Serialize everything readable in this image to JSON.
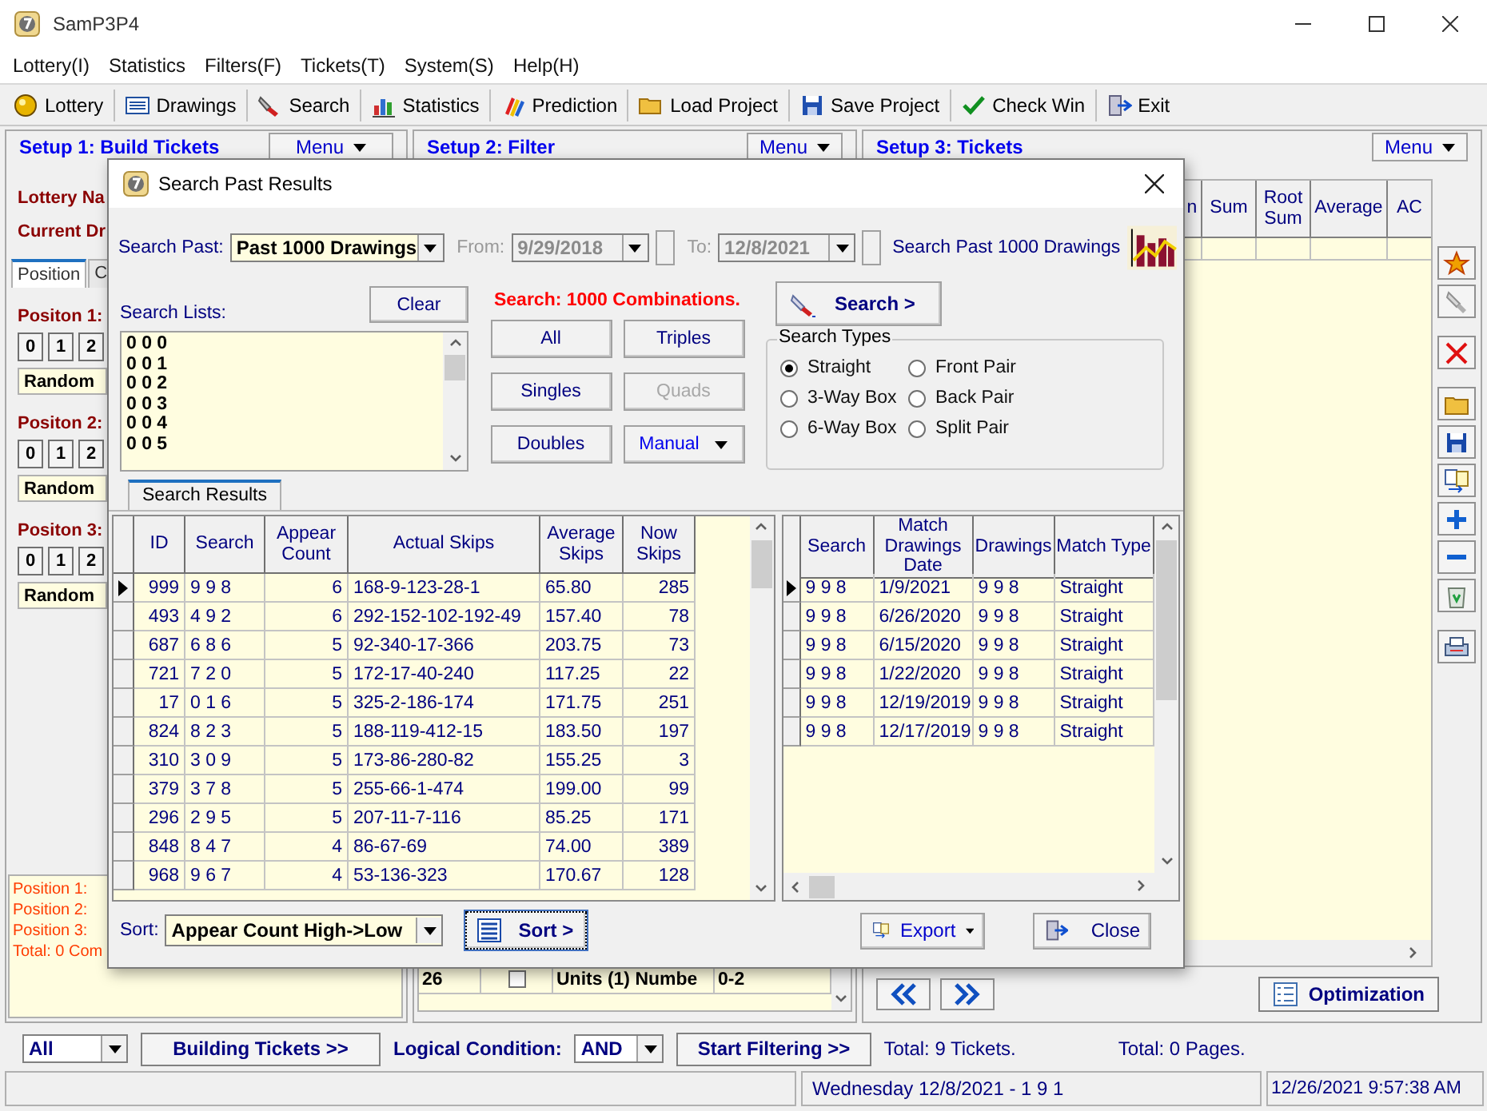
{
  "window": {
    "title": "SamP3P4"
  },
  "menu": [
    "Lottery(I)",
    "Statistics",
    "Filters(F)",
    "Tickets(T)",
    "System(S)",
    "Help(H)"
  ],
  "toolbar": [
    "Lottery",
    "Drawings",
    "Search",
    "Statistics",
    "Prediction",
    "Load Project",
    "Save Project",
    "Check Win",
    "Exit"
  ],
  "panel1": {
    "title": "Setup 1: Build Tickets",
    "menu_button": "Menu",
    "fields": [
      "Lottery Na",
      "Current Dr"
    ],
    "tabs": [
      {
        "label": "Position",
        "selected": true
      },
      {
        "label": "C",
        "selected": false
      }
    ],
    "positions": [
      {
        "label": "Positon 1:",
        "digits": [
          "0",
          "1",
          "2"
        ],
        "mode": "Random"
      },
      {
        "label": "Positon 2:",
        "digits": [
          "0",
          "1",
          "2"
        ],
        "mode": "Random"
      },
      {
        "label": "Positon 3:",
        "digits": [
          "0",
          "1",
          "2"
        ],
        "mode": "Random"
      }
    ],
    "summary": [
      "Position 1:",
      "Position 2:",
      "Position 3:",
      "Total: 0 Com"
    ]
  },
  "panel2": {
    "title": "Setup 2: Filter",
    "menu_button": "Menu",
    "row": {
      "number": "26",
      "checked": false,
      "name": "Units (1) Numbe",
      "range": "0-2"
    }
  },
  "panel3": {
    "title": "Setup 3: Tickets",
    "menu_button": "Menu",
    "columns": [
      "n",
      "Sum",
      "Root Sum",
      "Average",
      "AC"
    ],
    "optimization_button": "Optimization"
  },
  "dialog": {
    "title": "Search Past Results",
    "search_past_label": "Search Past:",
    "search_past": "Past 1000 Drawings",
    "from_label": "From:",
    "from": "9/29/2018",
    "to_label": "To:",
    "to": "12/8/2021",
    "dates_disabled": true,
    "range_note": "Search Past 1000 Drawings",
    "lists_label": "Search Lists:",
    "clear_button": "Clear",
    "search_list": [
      "0 0 0",
      "0 0 1",
      "0 0 2",
      "0 0 3",
      "0 0 4",
      "0 0 5"
    ],
    "combinations": "Search: 1000 Combinations.",
    "quick_buttons": [
      {
        "label": "All",
        "kind": "plain",
        "disabled": false
      },
      {
        "label": "Triples",
        "kind": "plain",
        "disabled": false
      },
      {
        "label": "Singles",
        "kind": "plain",
        "disabled": false
      },
      {
        "label": "Quads",
        "kind": "plain",
        "disabled": true
      },
      {
        "label": "Doubles",
        "kind": "plain",
        "disabled": false
      },
      {
        "label": "Manual",
        "kind": "dropdown",
        "disabled": false
      }
    ],
    "search_button": "Search >",
    "search_types_label": "Search Types",
    "search_types": [
      {
        "label": "Straight",
        "selected": true
      },
      {
        "label": "Front Pair",
        "selected": false
      },
      {
        "label": "3-Way Box",
        "selected": false
      },
      {
        "label": "Back Pair",
        "selected": false
      },
      {
        "label": "6-Way Box",
        "selected": false
      },
      {
        "label": "Split Pair",
        "selected": false
      }
    ],
    "results_tab": "Search Results",
    "results": {
      "columns": [
        "ID",
        "Search",
        "Appear Count",
        "Actual Skips",
        "Average Skips",
        "Now Skips"
      ],
      "rows": [
        {
          "selected": true,
          "cells": [
            "999",
            "9 9 8",
            "6",
            "168-9-123-28-1",
            "65.80",
            "285"
          ]
        },
        {
          "selected": false,
          "cells": [
            "493",
            "4 9 2",
            "6",
            "292-152-102-192-49",
            "157.40",
            "78"
          ]
        },
        {
          "selected": false,
          "cells": [
            "687",
            "6 8 6",
            "5",
            "92-340-17-366",
            "203.75",
            "73"
          ]
        },
        {
          "selected": false,
          "cells": [
            "721",
            "7 2 0",
            "5",
            "172-17-40-240",
            "117.25",
            "22"
          ]
        },
        {
          "selected": false,
          "cells": [
            "17",
            "0 1 6",
            "5",
            "325-2-186-174",
            "171.75",
            "251"
          ]
        },
        {
          "selected": false,
          "cells": [
            "824",
            "8 2 3",
            "5",
            "188-119-412-15",
            "183.50",
            "197"
          ]
        },
        {
          "selected": false,
          "cells": [
            "310",
            "3 0 9",
            "5",
            "173-86-280-82",
            "155.25",
            "3"
          ]
        },
        {
          "selected": false,
          "cells": [
            "379",
            "3 7 8",
            "5",
            "255-66-1-474",
            "199.00",
            "99"
          ]
        },
        {
          "selected": false,
          "cells": [
            "296",
            "2 9 5",
            "5",
            "207-11-7-116",
            "85.25",
            "171"
          ]
        },
        {
          "selected": false,
          "cells": [
            "848",
            "8 4 7",
            "4",
            "86-67-69",
            "74.00",
            "389"
          ]
        },
        {
          "selected": false,
          "cells": [
            "968",
            "9 6 7",
            "4",
            "53-136-323",
            "170.67",
            "128"
          ]
        }
      ]
    },
    "matches": {
      "columns": [
        "Search",
        "Match Drawings Date",
        "Drawings",
        "Match Type"
      ],
      "rows": [
        {
          "selected": true,
          "cells": [
            "9 9 8",
            "1/9/2021",
            "9 9 8",
            "Straight"
          ]
        },
        {
          "selected": false,
          "cells": [
            "9 9 8",
            "6/26/2020",
            "9 9 8",
            "Straight"
          ]
        },
        {
          "selected": false,
          "cells": [
            "9 9 8",
            "6/15/2020",
            "9 9 8",
            "Straight"
          ]
        },
        {
          "selected": false,
          "cells": [
            "9 9 8",
            "1/22/2020",
            "9 9 8",
            "Straight"
          ]
        },
        {
          "selected": false,
          "cells": [
            "9 9 8",
            "12/19/2019",
            "9 9 8",
            "Straight"
          ]
        },
        {
          "selected": false,
          "cells": [
            "9 9 8",
            "12/17/2019",
            "9 9 8",
            "Straight"
          ]
        }
      ]
    },
    "sort_label": "Sort:",
    "sort_value": "Appear Count High->Low",
    "sort_button": "Sort >",
    "export_button": "Export",
    "close_button": "Close"
  },
  "bottom_bar": {
    "filter": "All",
    "build_button": "Building  Tickets >>",
    "logic_label": "Logical Condition:",
    "logic_value": "AND",
    "start_button": "Start Filtering  >>",
    "tickets_total": "Total: 9 Tickets.",
    "pages_total": "Total: 0 Pages."
  },
  "status_bar": {
    "draw": "Wednesday 12/8/2021 - 1 9 1",
    "clock": "12/26/2021 9:57:38 AM"
  }
}
